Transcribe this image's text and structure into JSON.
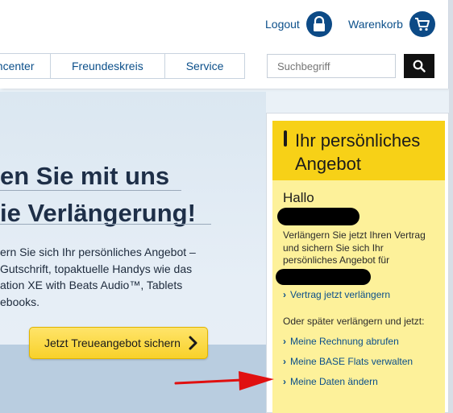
{
  "header": {
    "logout_label": "Logout",
    "cart_label": "Warenkorb",
    "logout_icon": "lock-icon",
    "cart_icon": "cart-icon"
  },
  "nav": {
    "items": [
      {
        "label": "encenter"
      },
      {
        "label": "Freundeskreis"
      },
      {
        "label": "Service"
      }
    ]
  },
  "search": {
    "placeholder": "Suchbegriff",
    "button_icon": "search-icon"
  },
  "hero": {
    "title_line1": "en Sie mit uns",
    "title_line2": "ie Verlängerung!",
    "text_lines": [
      "ern Sie sich Ihr persönliches Angebot –",
      " Gutschrift, topaktuelle Handys wie das",
      "ation XE with Beats Audio™, Tablets",
      "ebooks."
    ],
    "cta_label": "Jetzt Treueangebot sichern"
  },
  "offer": {
    "title": "Ihr persönliches Angebot",
    "greeting": "Hallo",
    "text": "Verlängern Sie jetzt Ihren Vertrag und sichern Sie sich Ihr persönliches Angebot für",
    "primary_link": "Vertrag jetzt verlängern",
    "later_text": "Oder später verlängern und jetzt:",
    "links": [
      {
        "label": "Meine Rechnung abrufen"
      },
      {
        "label": "Meine BASE Flats verwalten"
      },
      {
        "label": "Meine Daten ändern"
      }
    ]
  },
  "colors": {
    "brand_blue": "#0b4f8a",
    "offer_yellow": "#f7d117",
    "offer_light": "#fdf19a",
    "annotation_red": "#e01010"
  }
}
